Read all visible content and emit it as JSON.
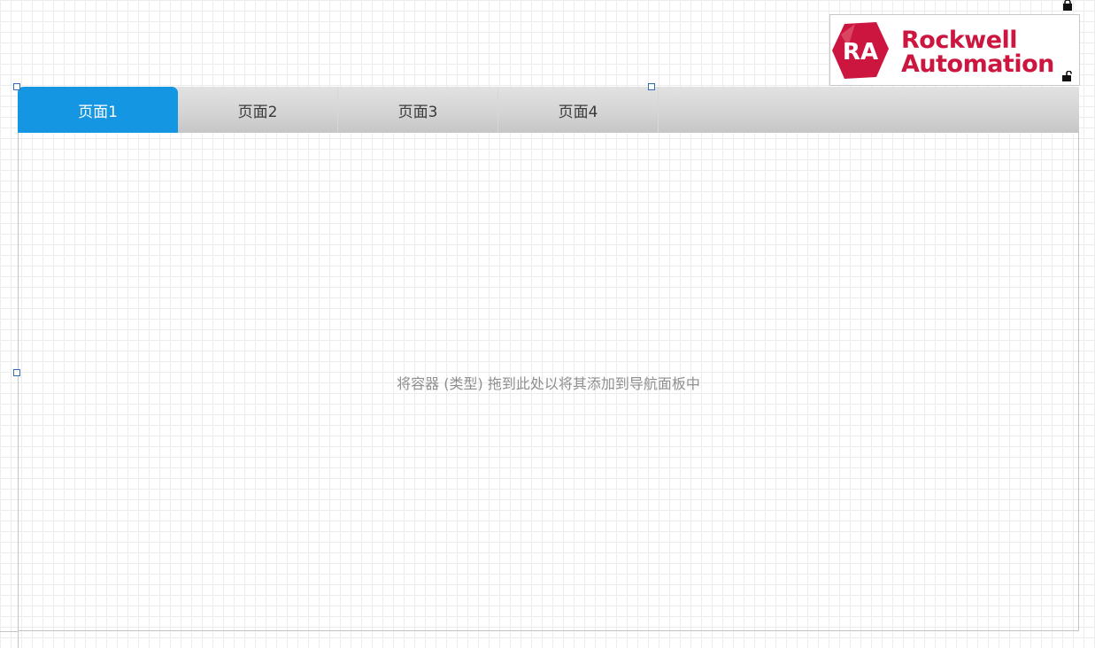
{
  "logo": {
    "badge": "RA",
    "line1": "Rockwell",
    "line2": "Automation",
    "brand_color": "#cd163f"
  },
  "navigation": {
    "tabs": [
      {
        "label": "页面1",
        "active": true
      },
      {
        "label": "页面2",
        "active": false
      },
      {
        "label": "页面3",
        "active": false
      },
      {
        "label": "页面4",
        "active": false
      }
    ],
    "active_color": "#1596e3",
    "placeholder": "将容器 (类型) 拖到此处以将其添加到导航面板中"
  },
  "icons": {
    "top_right_lock": "lock-icon",
    "logo_lock": "unlocked-lock-icon"
  }
}
